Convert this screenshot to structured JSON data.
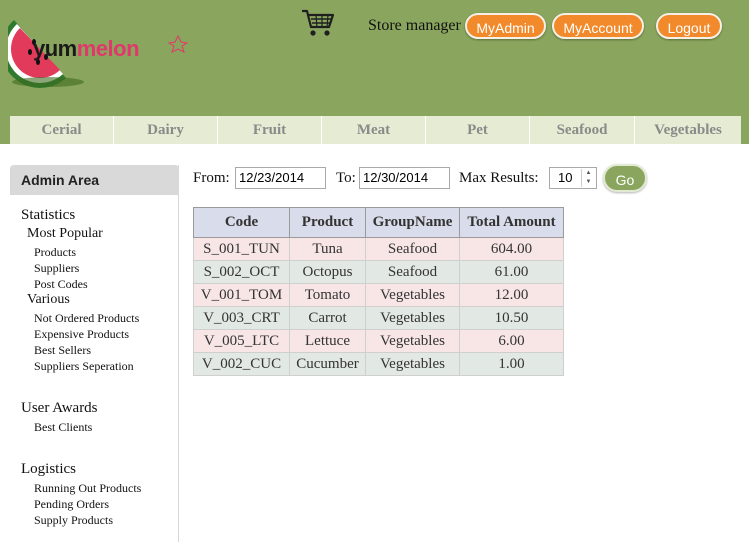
{
  "brand": {
    "logo_part1": "yum",
    "logo_part2": "melon"
  },
  "header": {
    "store_manager": "Store manager",
    "buttons": {
      "myadmin": "MyAdmin",
      "myaccount": "MyAccount",
      "logout": "Logout"
    }
  },
  "categories": [
    "Cerial",
    "Dairy",
    "Fruit",
    "Meat",
    "Pet",
    "Seafood",
    "Vegetables"
  ],
  "sidebar": {
    "title": "Admin Area",
    "statistics": "Statistics",
    "most_popular": "Most Popular",
    "most_popular_links": [
      "Products",
      "Suppliers",
      "Post Codes"
    ],
    "various": "Various",
    "various_links": [
      "Not Ordered Products",
      "Expensive Products",
      "Best Sellers",
      "Suppliers Seperation"
    ],
    "user_awards": "User Awards",
    "user_awards_links": [
      "Best Clients"
    ],
    "logistics": "Logistics",
    "logistics_links": [
      "Running Out Products",
      "Pending Orders",
      "Supply Products"
    ]
  },
  "filters": {
    "from_label": "From:",
    "from_value": "12/23/2014",
    "to_label": "To:",
    "to_value": "12/30/2014",
    "max_label": "Max Results:",
    "max_value": "10",
    "go": "Go"
  },
  "table": {
    "headers": [
      "Code",
      "Product",
      "GroupName",
      "Total Amount"
    ],
    "rows": [
      [
        "S_001_TUN",
        "Tuna",
        "Seafood",
        "604.00"
      ],
      [
        "S_002_OCT",
        "Octopus",
        "Seafood",
        "61.00"
      ],
      [
        "V_001_TOM",
        "Tomato",
        "Vegetables",
        "12.00"
      ],
      [
        "V_003_CRT",
        "Carrot",
        "Vegetables",
        "10.50"
      ],
      [
        "V_005_LTC",
        "Lettuce",
        "Vegetables",
        "6.00"
      ],
      [
        "V_002_CUC",
        "Cucumber",
        "Vegetables",
        "1.00"
      ]
    ]
  },
  "colors": {
    "header_bg": "#8aa65e",
    "button_orange": "#f28a2c",
    "nav_bg": "#e5ecd3",
    "row_pink": "#f8e6e6",
    "row_green": "#e2e8e3"
  }
}
